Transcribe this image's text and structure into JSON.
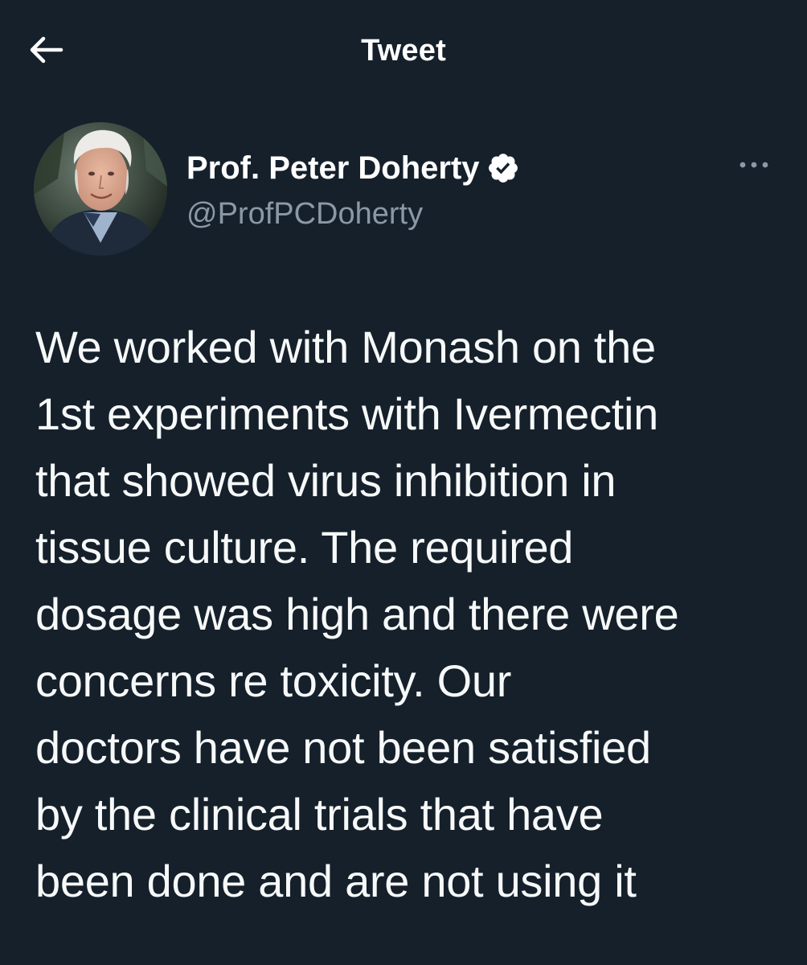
{
  "header": {
    "title": "Tweet",
    "back_icon": "arrow-left-icon"
  },
  "author": {
    "name": "Prof. Peter Doherty",
    "handle": "@ProfPCDoherty",
    "verified": true,
    "verified_icon": "verified-badge-icon",
    "more_icon": "more-horizontal-icon",
    "avatar_icon": "avatar-photo"
  },
  "tweet": {
    "lines": [
      "We worked with Monash on the",
      "1st experiments with Ivermectin",
      "that showed virus inhibition in",
      "tissue culture. The required",
      "dosage was high and there were",
      "concerns re toxicity. Our",
      "doctors have not been satisfied",
      "by the clinical trials that have",
      "been done and are not using it"
    ]
  },
  "colors": {
    "background": "#15202b",
    "text_primary": "#ffffff",
    "text_secondary": "#8b98a5"
  }
}
